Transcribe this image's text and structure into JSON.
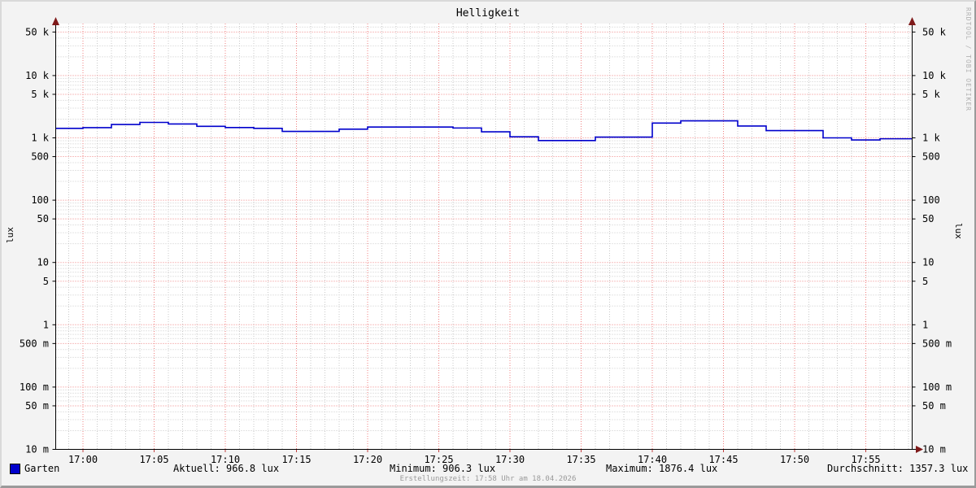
{
  "chart_data": {
    "type": "line",
    "title": "Helligkeit",
    "ylabel_left": "lux",
    "ylabel_right": "lux",
    "y_scale": "log",
    "ylim": [
      0.01,
      68000
    ],
    "x_start_label": "17:00",
    "x_ticks": [
      {
        "min": 0,
        "label": "17:00"
      },
      {
        "min": 5,
        "label": "17:05"
      },
      {
        "min": 10,
        "label": "17:10"
      },
      {
        "min": 15,
        "label": "17:15"
      },
      {
        "min": 20,
        "label": "17:20"
      },
      {
        "min": 25,
        "label": "17:25"
      },
      {
        "min": 30,
        "label": "17:30"
      },
      {
        "min": 35,
        "label": "17:35"
      },
      {
        "min": 40,
        "label": "17:40"
      },
      {
        "min": 45,
        "label": "17:45"
      },
      {
        "min": 50,
        "label": "17:50"
      },
      {
        "min": 55,
        "label": "17:55"
      }
    ],
    "y_ticks": [
      {
        "value": 50000,
        "label": "50 k"
      },
      {
        "value": 10000,
        "label": "10 k"
      },
      {
        "value": 5000,
        "label": "5 k"
      },
      {
        "value": 1000,
        "label": "1 k"
      },
      {
        "value": 500,
        "label": "500"
      },
      {
        "value": 100,
        "label": "100"
      },
      {
        "value": 50,
        "label": "50"
      },
      {
        "value": 10,
        "label": "10"
      },
      {
        "value": 5,
        "label": "5"
      },
      {
        "value": 1,
        "label": "1"
      },
      {
        "value": 0.5,
        "label": "500 m"
      },
      {
        "value": 0.1,
        "label": "100 m"
      },
      {
        "value": 0.05,
        "label": "50 m"
      },
      {
        "value": 0.01,
        "label": "10 m"
      }
    ],
    "grid": {
      "on": true,
      "major_color": "#f08080",
      "minor_color": "#c9c9c9"
    },
    "axis_color": "#000000",
    "arrow_color": "#7f1a1a",
    "canvas_color": "#ffffff",
    "background_color": "#f3f3f3",
    "legend_position": "bottom",
    "series": [
      {
        "name": "Garten",
        "color": "#0000cc",
        "points_unit": "minutes after 17:00, lux",
        "points": [
          [
            -2,
            1420
          ],
          [
            0,
            1460
          ],
          [
            2,
            1640
          ],
          [
            4,
            1770
          ],
          [
            6,
            1670
          ],
          [
            8,
            1530
          ],
          [
            10,
            1465
          ],
          [
            12,
            1420
          ],
          [
            14,
            1270
          ],
          [
            16,
            1270
          ],
          [
            18,
            1380
          ],
          [
            20,
            1490
          ],
          [
            22,
            1490
          ],
          [
            24,
            1490
          ],
          [
            26,
            1440
          ],
          [
            28,
            1250
          ],
          [
            30,
            1040
          ],
          [
            32,
            906
          ],
          [
            34,
            906
          ],
          [
            36,
            1030
          ],
          [
            38,
            1030
          ],
          [
            40,
            1725
          ],
          [
            42,
            1876
          ],
          [
            44,
            1876
          ],
          [
            46,
            1550
          ],
          [
            48,
            1310
          ],
          [
            50,
            1310
          ],
          [
            52,
            1000
          ],
          [
            54,
            925
          ],
          [
            56,
            967
          ],
          [
            58.3,
            967
          ]
        ]
      }
    ]
  },
  "legend": {
    "series_name": "Garten",
    "swatch_color": "#0000cc",
    "stats": [
      {
        "label": "Aktuell: 966.8 lux"
      },
      {
        "label": "Minimum: 906.3 lux"
      },
      {
        "label": "Maximum: 1876.4 lux"
      },
      {
        "label": "Durchschnitt: 1357.3 lux"
      }
    ]
  },
  "footer": {
    "creation_text": "Erstellungszeit: 17:58 Uhr am 18.04.2026"
  },
  "watermark": "RRDTOOL / TOBI OETIKER"
}
